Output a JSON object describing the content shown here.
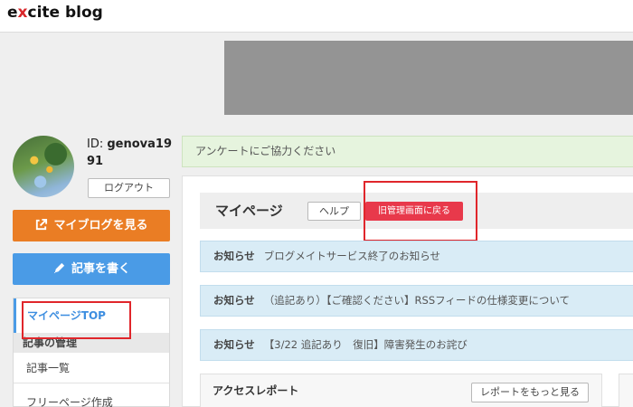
{
  "header": {
    "logo_prefix": "e",
    "logo_x": "x",
    "logo_suffix": "cite blog"
  },
  "profile": {
    "id_label": "ID: ",
    "id_value_line1": "genova19",
    "id_value_line2": "91",
    "logout_label": "ログアウト"
  },
  "actions": {
    "view_blog_label": "マイブログを見る",
    "write_post_label": "記事を書く"
  },
  "sidebar": {
    "active_item": "マイページTOP",
    "section_heading": "記事の管理",
    "items": [
      {
        "label": "記事一覧"
      },
      {
        "label": "フリーページ作成"
      }
    ]
  },
  "survey_banner": "アンケートにご協力ください",
  "mypage": {
    "title": "マイページ",
    "help_label": "ヘルプ",
    "old_admin_label": "旧管理画面に戻る"
  },
  "notices": [
    {
      "tag": "お知らせ",
      "text": "ブログメイトサービス終了のお知らせ"
    },
    {
      "tag": "お知らせ",
      "text": "（追記あり）【ご確認ください】RSSフィードの仕様変更について"
    },
    {
      "tag": "お知らせ",
      "text": "【3/22 追記あり　復旧】障害発生のお詫び"
    }
  ],
  "access_report": {
    "title": "アクセスレポート",
    "more_label": "レポートをもっと見る"
  },
  "colors": {
    "accent_orange": "#ea7d24",
    "accent_blue": "#4a9be6",
    "accent_red": "#e8394b",
    "highlight_box": "#e0262b"
  }
}
